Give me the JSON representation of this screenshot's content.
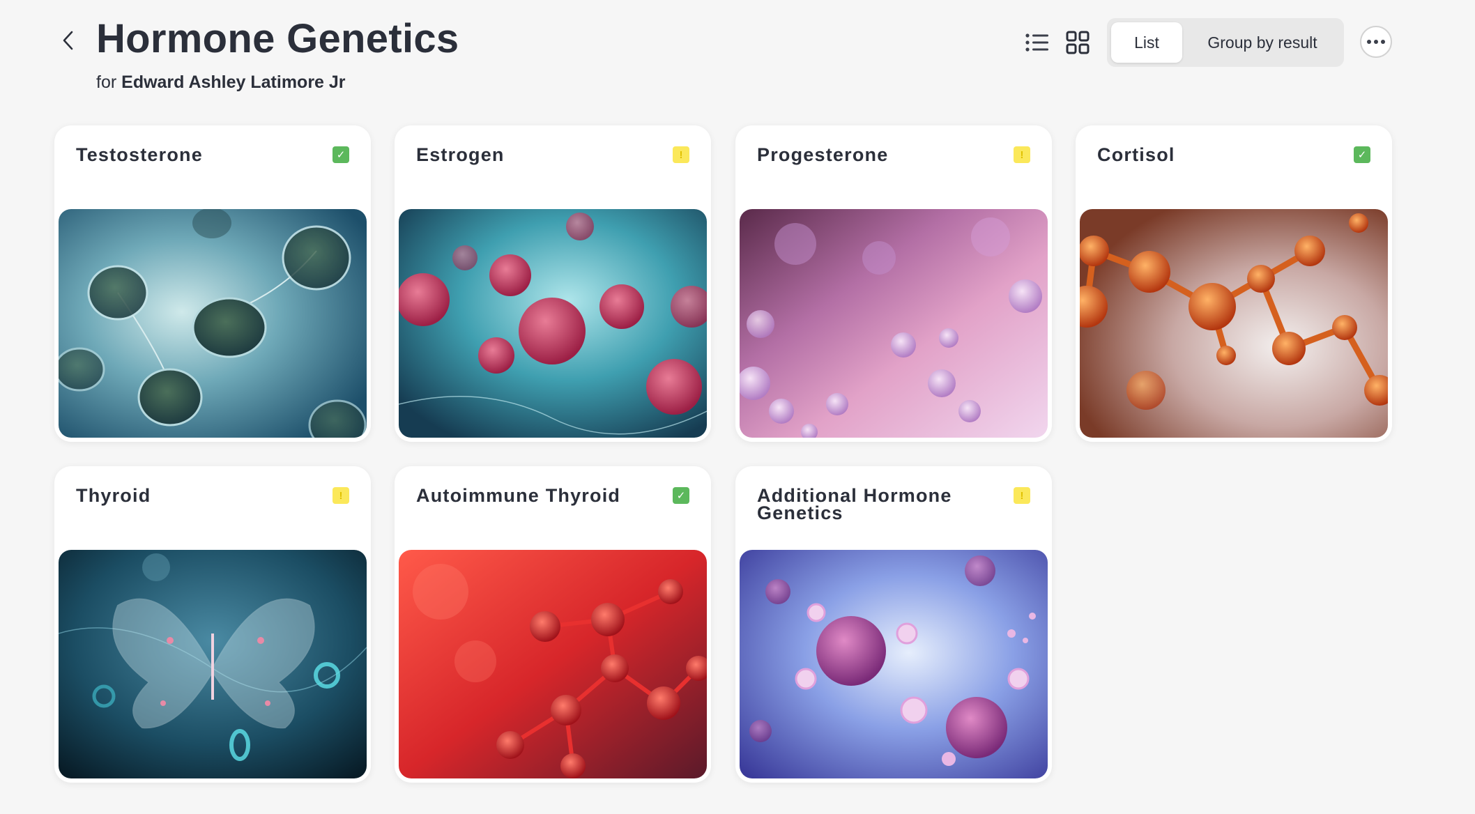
{
  "header": {
    "title": "Hormone Genetics",
    "subtitle_prefix": "for",
    "patient_name": "Edward Ashley Latimore Jr",
    "back_icon": "chevron-left-icon"
  },
  "toolbar": {
    "list_view_icon": "list-view-icon",
    "grid_view_icon": "grid-view-icon",
    "segments": [
      {
        "label": "List",
        "active": true
      },
      {
        "label": "Group by result",
        "active": false
      }
    ],
    "more_icon": "more-horizontal-icon"
  },
  "status_colors": {
    "check": "#5cb85c",
    "warn": "#fbe85a"
  },
  "cards": [
    {
      "title": "Testosterone",
      "status": "check",
      "image": "bluish cells illustration"
    },
    {
      "title": "Estrogen",
      "status": "warn",
      "image": "red cells on teal background"
    },
    {
      "title": "Progesterone",
      "status": "warn",
      "image": "purple cells illustration"
    },
    {
      "title": "Cortisol",
      "status": "check",
      "image": "orange molecules illustration"
    },
    {
      "title": "Thyroid",
      "status": "warn",
      "image": "butterfly shaped gland illustration"
    },
    {
      "title": "Autoimmune Thyroid",
      "status": "check",
      "image": "red molecules illustration"
    },
    {
      "title": "Additional Hormone Genetics",
      "status": "warn",
      "image": "pink virus cells on blue background"
    }
  ]
}
